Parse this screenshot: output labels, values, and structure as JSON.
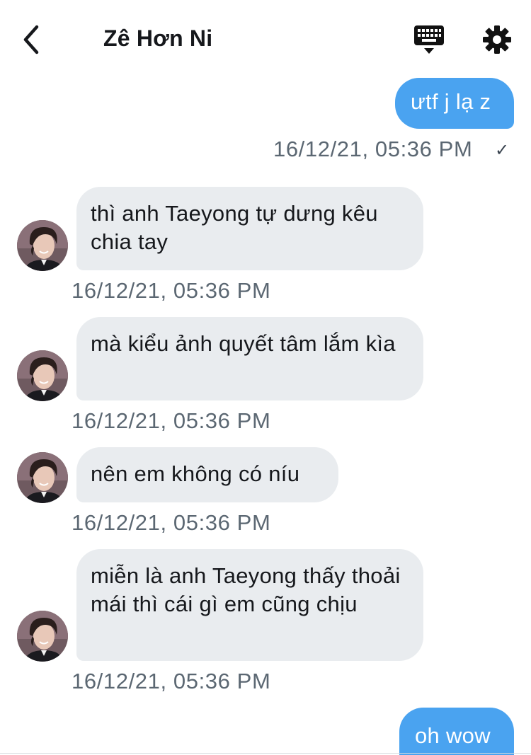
{
  "header": {
    "title": "Zê Hơn Ni",
    "back_icon": "chevron-left-icon",
    "keyboard_icon": "keyboard-icon",
    "settings_icon": "gear-icon"
  },
  "colors": {
    "outgoing_bubble": "#4aa3f0",
    "incoming_bubble": "#e9ecef",
    "timestamp": "#5b6772"
  },
  "messages": [
    {
      "direction": "out",
      "text": "ưtf j lạ z",
      "timestamp": "16/12/21, 05:36 PM",
      "status": "✓"
    },
    {
      "direction": "in",
      "text": "thì anh Taeyong tự dưng kêu chia tay",
      "timestamp": "16/12/21, 05:36 PM"
    },
    {
      "direction": "in",
      "text": "mà kiểu ảnh quyết tâm lắm kìa",
      "timestamp": "16/12/21, 05:36 PM"
    },
    {
      "direction": "in",
      "text": "nên em không có níu",
      "timestamp": "16/12/21, 05:36 PM"
    },
    {
      "direction": "in",
      "text": "miễn là anh Taeyong thấy thoải mái thì cái gì em cũng chịu",
      "timestamp": "16/12/21, 05:36 PM"
    },
    {
      "direction": "out",
      "text": "oh wow"
    }
  ]
}
